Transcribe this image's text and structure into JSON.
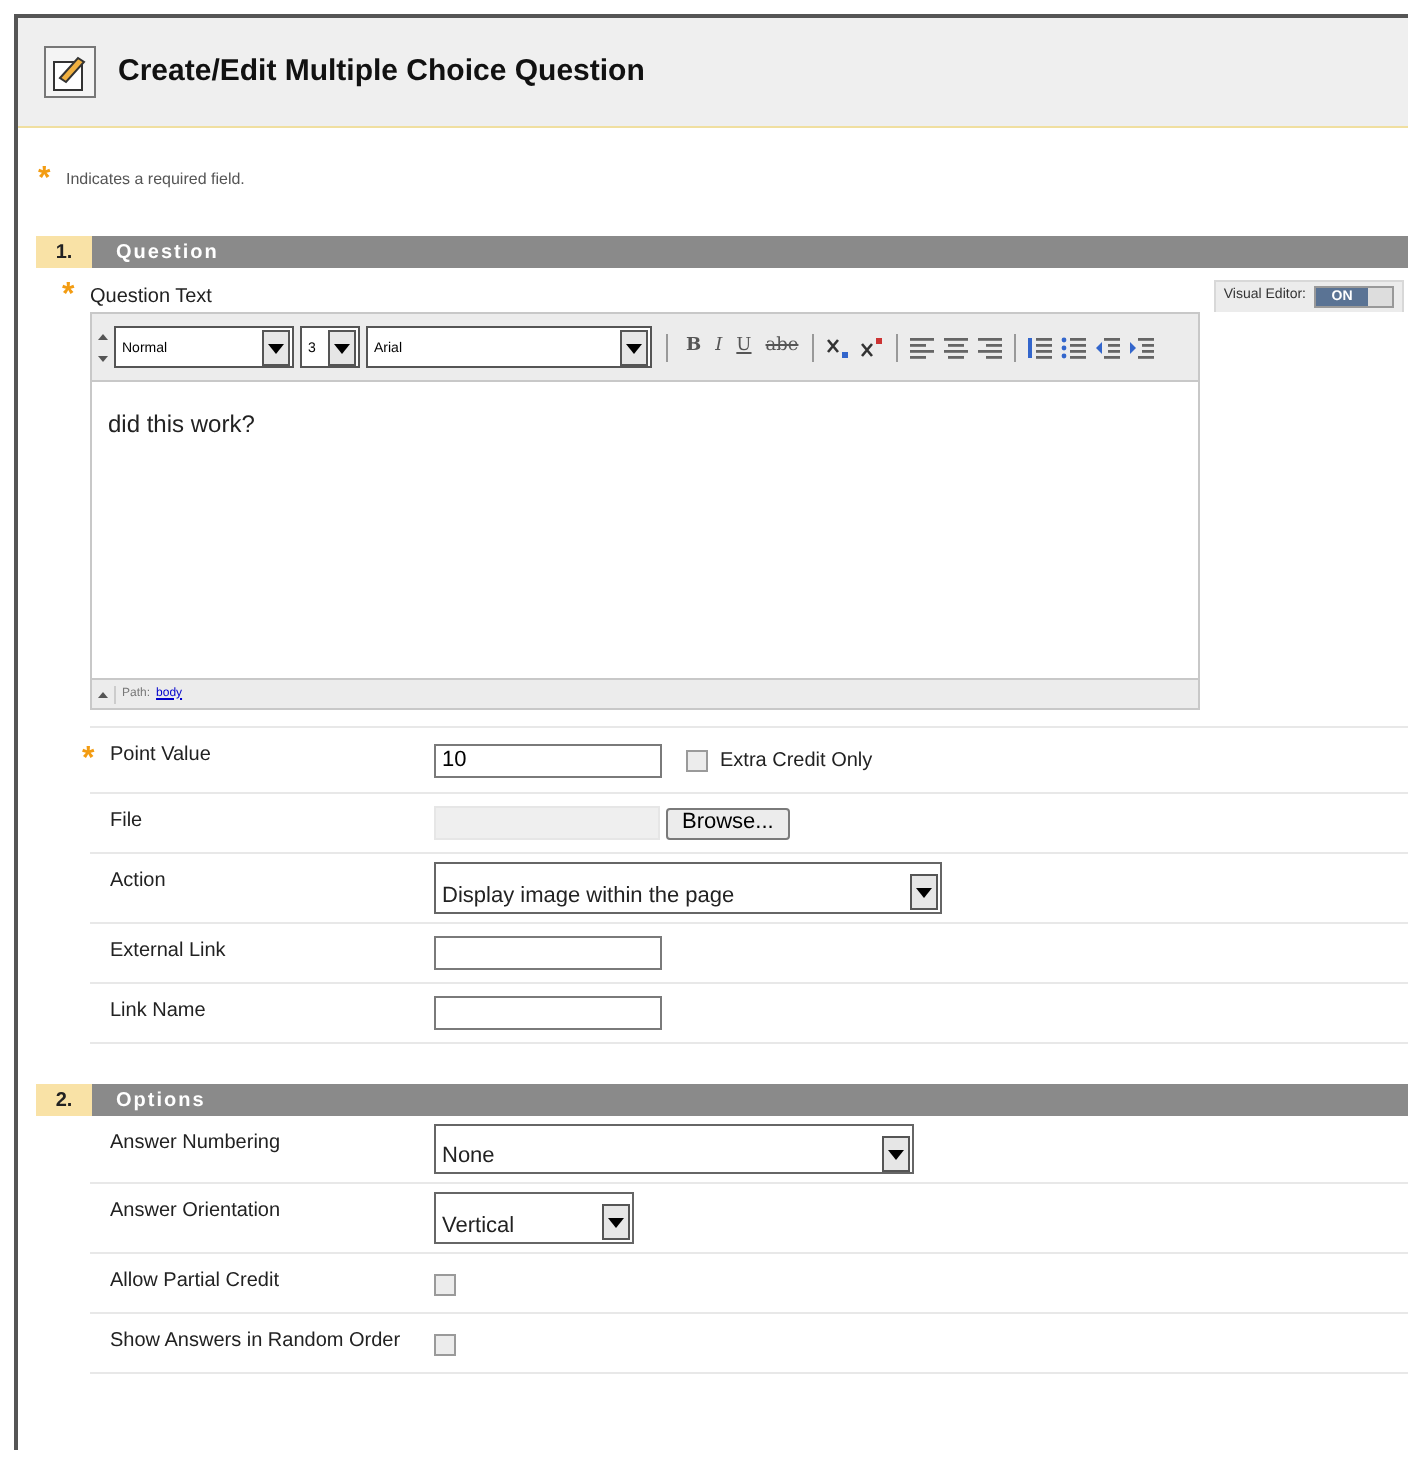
{
  "header": {
    "title": "Create/Edit Multiple Choice Question"
  },
  "required_note": {
    "mark": "*",
    "text": "Indicates a required field."
  },
  "sections": [
    {
      "number": "1.",
      "title": "Question",
      "editor": {
        "label": "Question Text",
        "required": true,
        "visual_editor": {
          "label": "Visual Editor:",
          "state": "ON",
          "on": true
        },
        "selects": [
          {
            "value": "Normal",
            "kind": "wide"
          },
          {
            "value": "3",
            "kind": "narrow"
          },
          {
            "value": "Arial",
            "kind": "wide"
          }
        ],
        "format_buttons": [
          {
            "label": "B",
            "kind": "bold"
          },
          {
            "label": "I",
            "kind": "italic"
          },
          {
            "label": "U",
            "kind": "underline"
          },
          {
            "label": "abe",
            "kind": "strike"
          }
        ],
        "content": "did this work?",
        "path_label": "Path:",
        "path_link": "body"
      },
      "fields": [
        {
          "kind": "text",
          "label": "Point Value",
          "required": true,
          "value": "10",
          "checkbox": {
            "label": "Extra Credit Only",
            "checked": false
          }
        },
        {
          "kind": "file",
          "label": "File",
          "required": false,
          "button": "Browse..."
        },
        {
          "kind": "select",
          "label": "Action",
          "required": false,
          "value": "Display image within the page"
        },
        {
          "kind": "text",
          "label": "External Link",
          "required": false
        },
        {
          "kind": "text",
          "label": "Link Name",
          "required": false
        }
      ]
    },
    {
      "number": "2.",
      "title": "Options",
      "fields": [
        {
          "kind": "select",
          "label": "Answer Numbering",
          "required": false,
          "value": "None"
        },
        {
          "kind": "select",
          "label": "Answer Orientation",
          "required": false,
          "value": "Vertical"
        },
        {
          "kind": "checkbox",
          "label": "Allow Partial Credit",
          "required": false,
          "checked": false
        },
        {
          "kind": "checkbox",
          "label": "Show Answers in Random Order",
          "required": false,
          "checked": false
        }
      ]
    }
  ]
}
